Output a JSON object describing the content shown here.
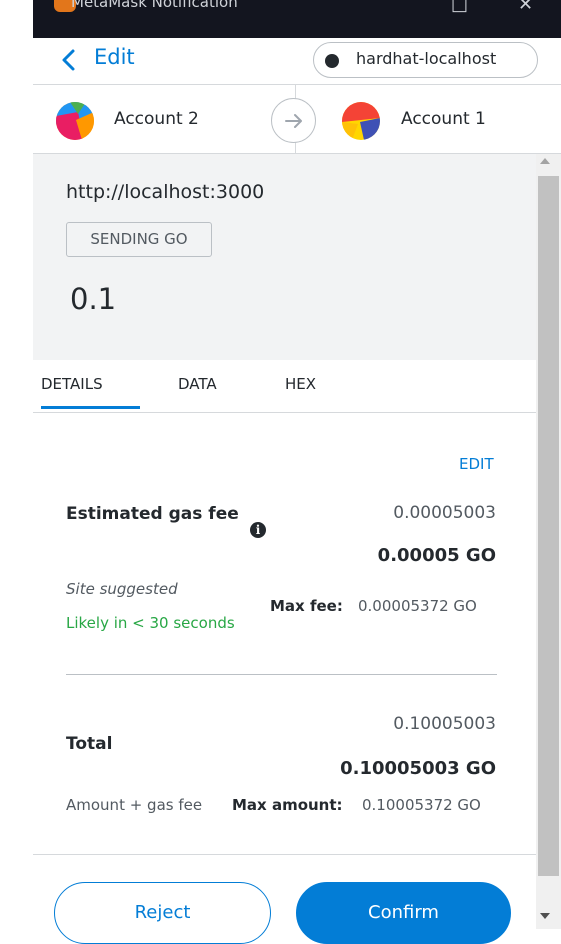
{
  "window": {
    "title": "MetaMask Notification"
  },
  "header": {
    "back_label": "Edit",
    "network": "hardhat-localhost"
  },
  "accounts": {
    "from": "Account 2",
    "to": "Account 1"
  },
  "summary": {
    "origin": "http://localhost:3000",
    "action_badge": "SENDING GO",
    "amount": "0.1"
  },
  "tabs": [
    {
      "label": "DETAILS",
      "active": true
    },
    {
      "label": "DATA",
      "active": false
    },
    {
      "label": "HEX",
      "active": false
    }
  ],
  "gas": {
    "edit_label": "EDIT",
    "title": "Estimated gas fee",
    "info_glyph": "i",
    "fiat_value": "0.00005003",
    "native_value": "0.00005 GO",
    "site_suggested": "Site suggested",
    "likely": "Likely in < 30 seconds",
    "max_fee_label": "Max fee:",
    "max_fee_value": "0.00005372 GO"
  },
  "total": {
    "label": "Total",
    "fiat_value": "0.10005003",
    "native_value": "0.10005003 GO",
    "sub_label": "Amount + gas fee",
    "max_amount_label": "Max amount:",
    "max_amount_value": "0.10005372 GO"
  },
  "footer": {
    "reject_label": "Reject",
    "confirm_label": "Confirm"
  },
  "colors": {
    "accent": "#037dd6",
    "success": "#28a745",
    "text": "#24292e",
    "muted": "#535a61"
  }
}
